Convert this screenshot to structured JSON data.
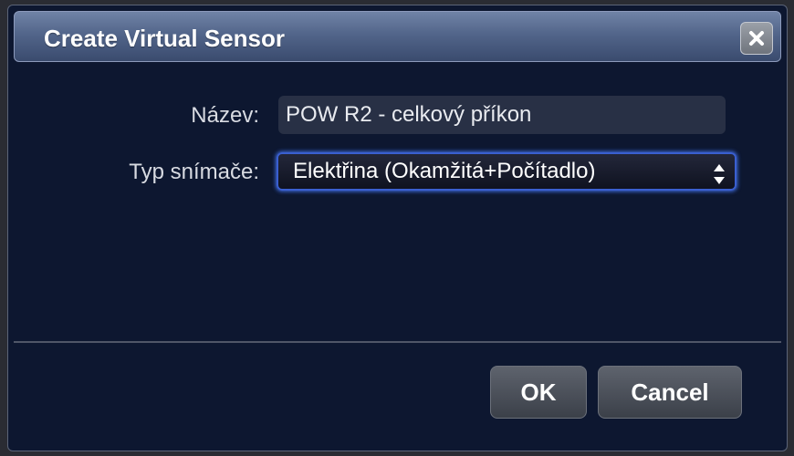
{
  "dialog": {
    "title": "Create Virtual Sensor",
    "close_icon": "close-icon"
  },
  "form": {
    "name_label": "Název:",
    "name_value": "POW R2 - celkový příkon",
    "type_label": "Typ snímače:",
    "type_selected": "Elektřina (Okamžitá+Počítadlo)"
  },
  "buttons": {
    "ok_label": "OK",
    "cancel_label": "Cancel"
  },
  "colors": {
    "dialog_bg": "#0d1730",
    "titlebar": "#52658a",
    "focus_ring": "#3f6de0"
  }
}
